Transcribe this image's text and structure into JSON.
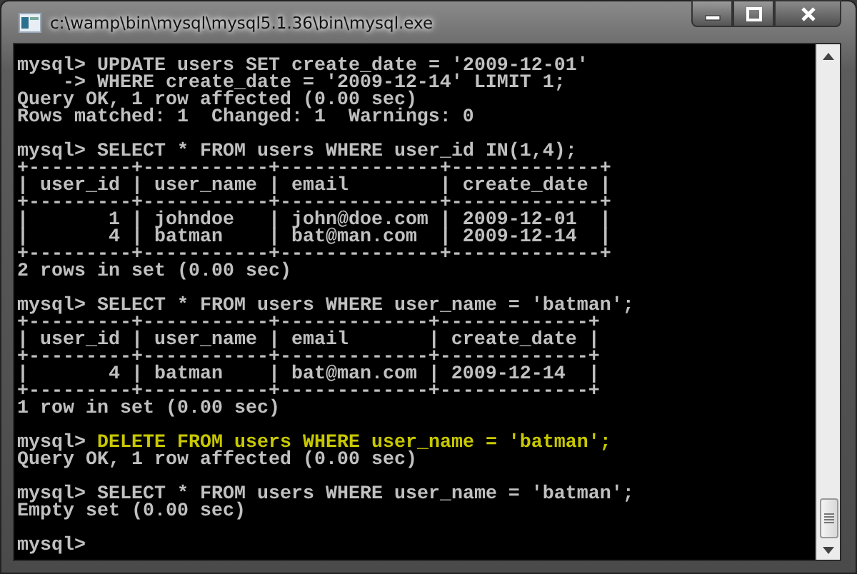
{
  "window": {
    "title": "c:\\wamp\\bin\\mysql\\mysql5.1.36\\bin\\mysql.exe"
  },
  "console": {
    "blocks": [
      {
        "lines": [
          {
            "prompt": "mysql>",
            "text": "UPDATE users SET create_date = '2009-12-01'",
            "highlighted": false
          },
          {
            "text": "    -> WHERE create_date = '2009-12-14' LIMIT 1;"
          },
          {
            "text": "Query OK, 1 row affected (0.00 sec)"
          },
          {
            "text": "Rows matched: 1  Changed: 1  Warnings: 0"
          }
        ]
      },
      {
        "lines": [
          {
            "prompt": "mysql>",
            "text": "SELECT * FROM users WHERE user_id IN(1,4);",
            "highlighted": false
          },
          {
            "text": "+---------+-----------+--------------+-------------+"
          },
          {
            "text": "| user_id | user_name | email        | create_date |"
          },
          {
            "text": "+---------+-----------+--------------+-------------+"
          },
          {
            "text": "|       1 | johndoe   | john@doe.com | 2009-12-01  |"
          },
          {
            "text": "|       4 | batman    | bat@man.com  | 2009-12-14  |"
          },
          {
            "text": "+---------+-----------+--------------+-------------+"
          },
          {
            "text": "2 rows in set (0.00 sec)"
          }
        ]
      },
      {
        "lines": [
          {
            "prompt": "mysql>",
            "text": "SELECT * FROM users WHERE user_name = 'batman';",
            "highlighted": false
          },
          {
            "text": "+---------+-----------+-------------+-------------+"
          },
          {
            "text": "| user_id | user_name | email       | create_date |"
          },
          {
            "text": "+---------+-----------+-------------+-------------+"
          },
          {
            "text": "|       4 | batman    | bat@man.com | 2009-12-14  |"
          },
          {
            "text": "+---------+-----------+-------------+-------------+"
          },
          {
            "text": "1 row in set (0.00 sec)"
          }
        ]
      },
      {
        "lines": [
          {
            "prompt": "mysql>",
            "text": "DELETE FROM users WHERE user_name = 'batman';",
            "highlighted": true
          },
          {
            "text": "Query OK, 1 row affected (0.00 sec)"
          }
        ]
      },
      {
        "lines": [
          {
            "prompt": "mysql>",
            "text": "SELECT * FROM users WHERE user_name = 'batman';",
            "highlighted": false
          },
          {
            "text": "Empty set (0.00 sec)"
          }
        ]
      },
      {
        "lines": [
          {
            "prompt": "mysql>"
          }
        ]
      }
    ]
  }
}
